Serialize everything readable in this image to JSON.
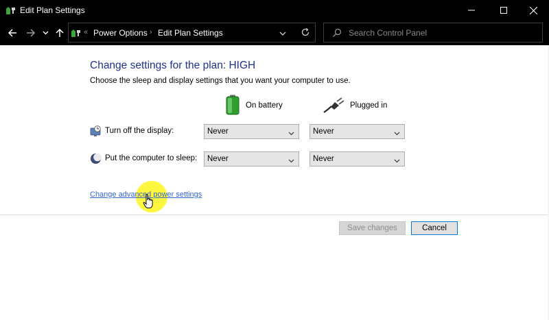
{
  "window": {
    "title": "Edit Plan Settings"
  },
  "address": {
    "chevrons": "«",
    "crumbs": [
      "Power Options",
      "Edit Plan Settings"
    ],
    "separator": "›"
  },
  "search": {
    "placeholder": "Search Control Panel"
  },
  "page": {
    "heading": "Change settings for the plan: HIGH",
    "subtext": "Choose the sleep and display settings that you want your computer to use.",
    "columns": {
      "battery": "On battery",
      "plugged": "Plugged in"
    },
    "rows": [
      {
        "label": "Turn off the display:",
        "battery": "Never",
        "plugged": "Never",
        "icon": "monitor-clock-icon"
      },
      {
        "label": "Put the computer to sleep:",
        "battery": "Never",
        "plugged": "Never",
        "icon": "moon-icon"
      }
    ],
    "advanced_link": "Change advanced power settings",
    "save_label": "Save changes",
    "cancel_label": "Cancel"
  },
  "colors": {
    "heading": "#1e3287",
    "link": "#3366cc",
    "chrome": "#000000",
    "cursor_highlight": "#fff51e"
  }
}
